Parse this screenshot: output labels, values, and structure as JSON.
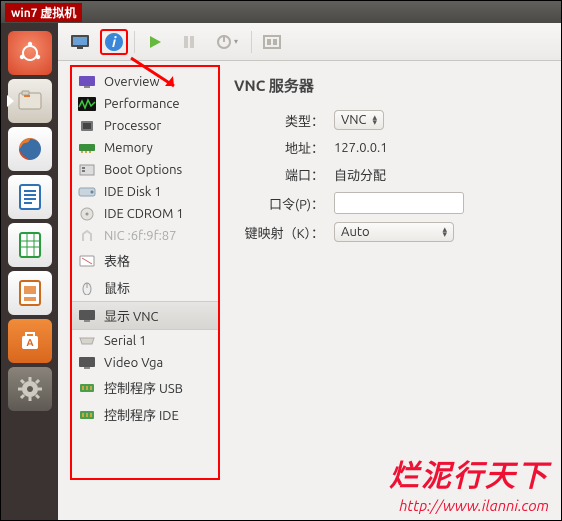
{
  "window": {
    "title": "win7 虚拟机"
  },
  "sidebar": {
    "items": [
      {
        "label": "Overview"
      },
      {
        "label": "Performance"
      },
      {
        "label": "Processor"
      },
      {
        "label": "Memory"
      },
      {
        "label": "Boot Options"
      },
      {
        "label": "IDE Disk 1"
      },
      {
        "label": "IDE CDROM 1"
      },
      {
        "label": "NIC :6f:9f:87"
      },
      {
        "label": "表格"
      },
      {
        "label": "鼠标"
      },
      {
        "label": "显示 VNC"
      },
      {
        "label": "Serial 1"
      },
      {
        "label": "Video Vga"
      },
      {
        "label": "控制程序 USB"
      },
      {
        "label": "控制程序 IDE"
      }
    ]
  },
  "details": {
    "title": "VNC 服务器",
    "rows": {
      "type_label": "类型：",
      "type_value": "VNC",
      "address_label": "地址：",
      "address_value": "127.0.0.1",
      "port_label": "端口：",
      "port_value": "自动分配",
      "password_label": "口令(P)：",
      "password_value": "",
      "keymap_label": "键映射（K）：",
      "keymap_value": "Auto"
    }
  },
  "watermark": {
    "text": "烂泥行天下",
    "url": "http://www.ilanni.com"
  }
}
